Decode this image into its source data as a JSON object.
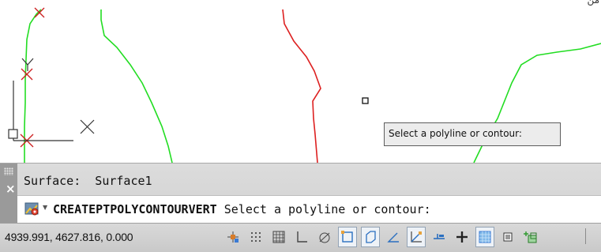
{
  "drawing": {
    "tooltip": "Select a polyline or contour:",
    "corner_text": "من"
  },
  "command_window": {
    "history_line": "Surface:  Surface1",
    "command_name": "CREATEPTPOLYCONTOURVERT",
    "prompt": "Select a polyline or contour:",
    "icon": "civil3d-command-icon"
  },
  "status_bar": {
    "coordinates": "4939.991, 4627.816, 0.000",
    "toggles": [
      {
        "name": "infer-constraints",
        "on": false
      },
      {
        "name": "snap-mode",
        "on": false
      },
      {
        "name": "grid-display",
        "on": false
      },
      {
        "name": "ortho-mode",
        "on": false
      },
      {
        "name": "polar-tracking",
        "on": false
      },
      {
        "name": "object-snap",
        "on": true
      },
      {
        "name": "3d-object-snap",
        "on": true
      },
      {
        "name": "object-snap-tracking",
        "on": false
      },
      {
        "name": "dynamic-ucs",
        "on": true
      },
      {
        "name": "dynamic-input",
        "on": false
      },
      {
        "name": "show-lineweight",
        "on": false
      },
      {
        "name": "transparency",
        "on": true
      },
      {
        "name": "quick-properties",
        "on": false
      },
      {
        "name": "selection-cycling",
        "on": false
      }
    ]
  },
  "colors": {
    "contour_green": "#22dd22",
    "contour_red": "#dd2020",
    "panel_gray": "#d4d4d4"
  }
}
